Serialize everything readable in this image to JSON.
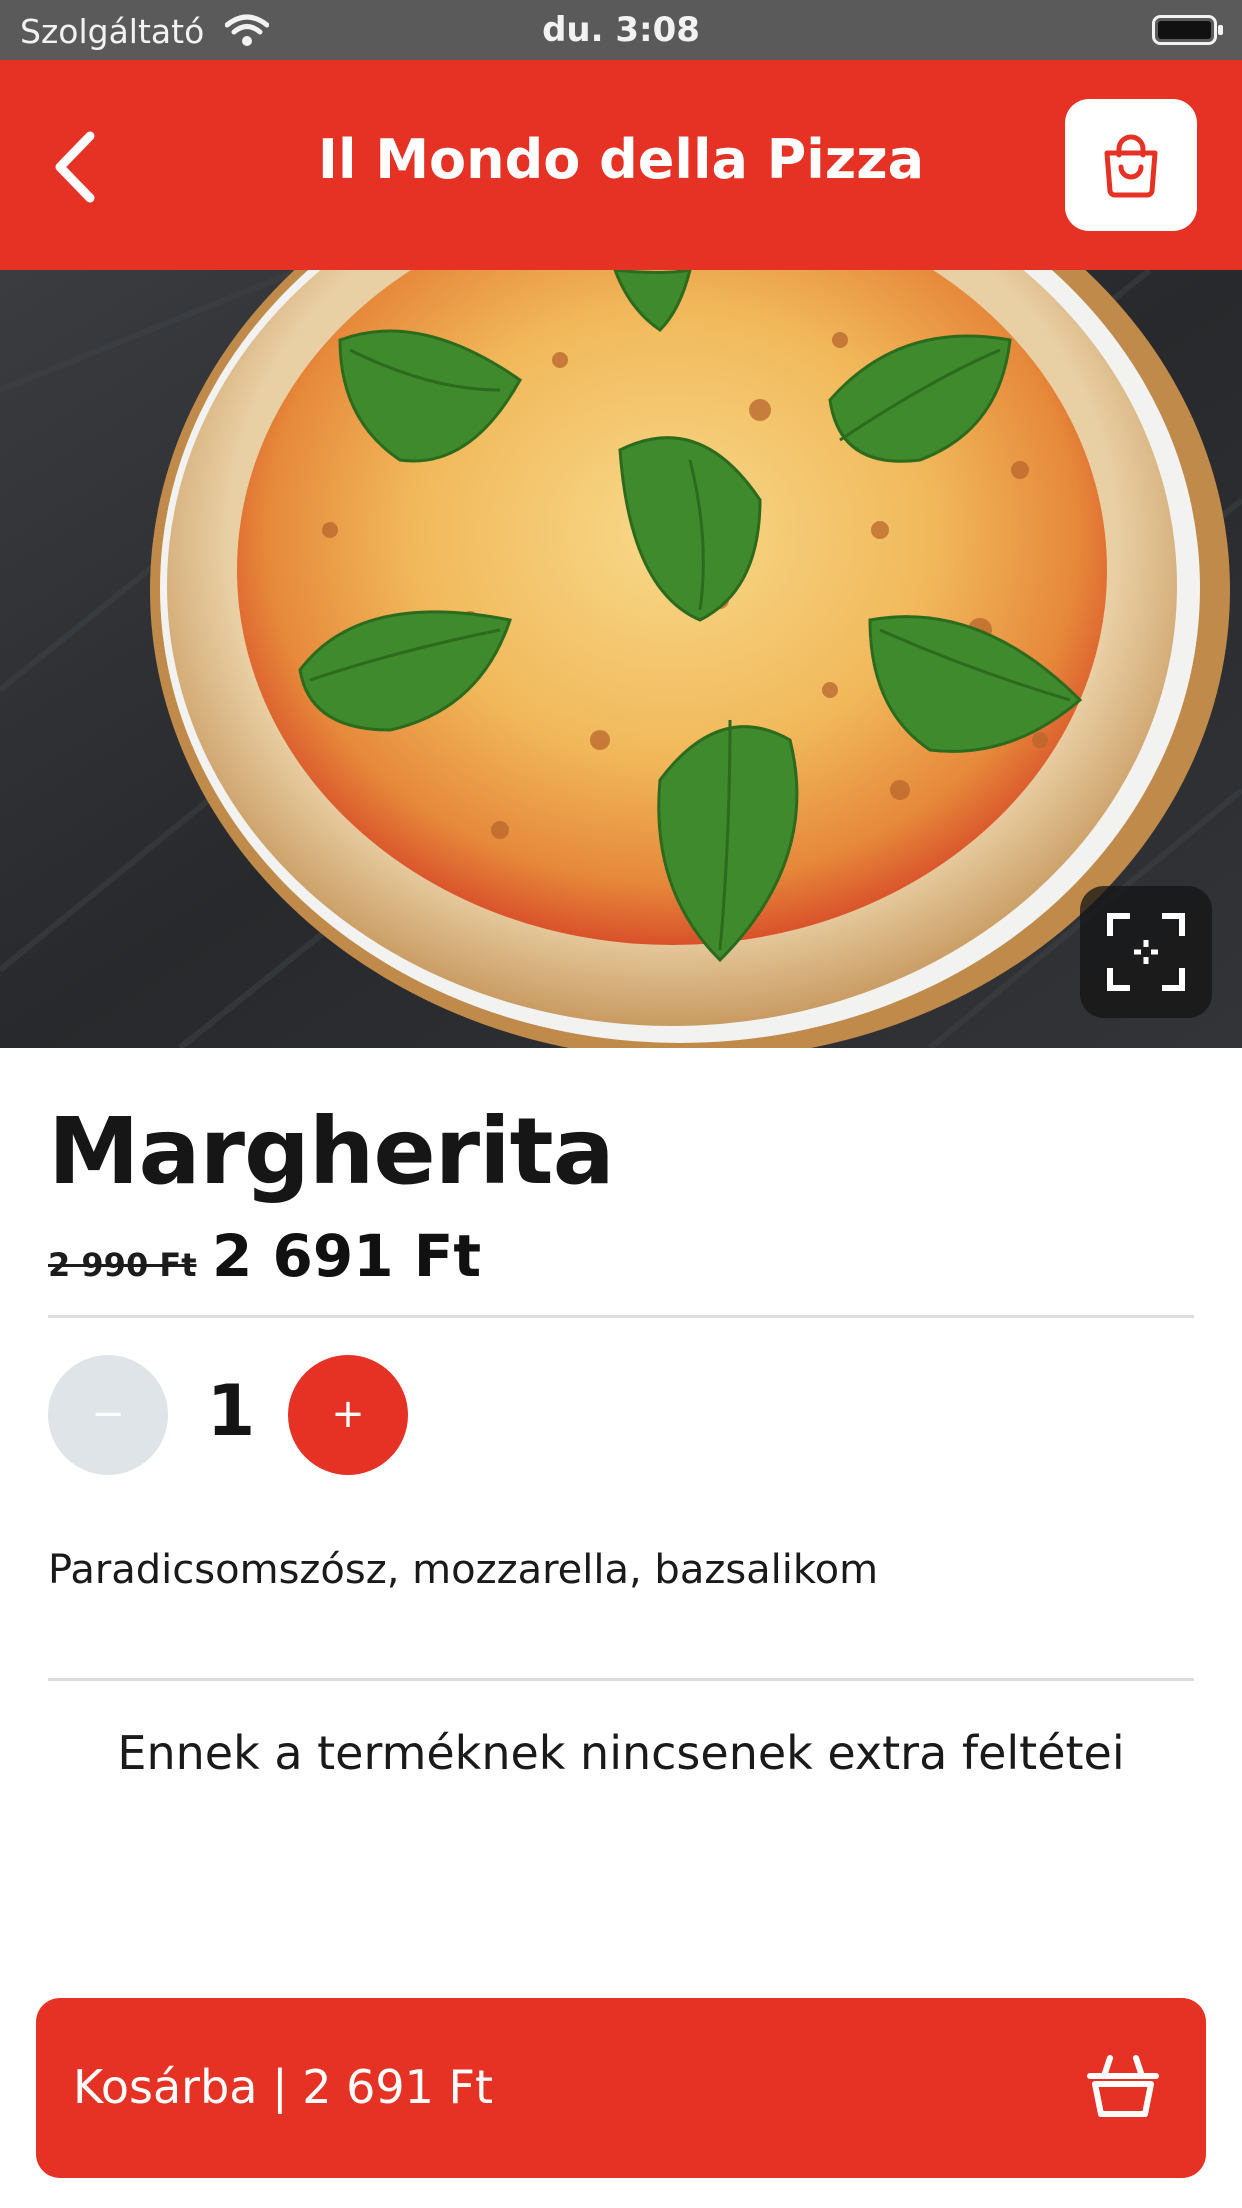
{
  "status_bar": {
    "carrier": "Szolgáltató",
    "time": "du. 3:08",
    "icons": [
      "wifi-icon",
      "battery-icon"
    ]
  },
  "header": {
    "title": "Il Mondo della Pizza",
    "back_icon": "chevron-left-icon",
    "cart_icon": "shopping-bag-icon",
    "background_color": "#e53224"
  },
  "image": {
    "description_icon": "pizza-photo",
    "fullscreen_icon": "fullscreen-icon"
  },
  "product": {
    "name": "Margherita",
    "old_price": "2 990 Ft",
    "price": "2 691 Ft",
    "description": "Paradicsomszósz, mozzarella, bazsalikom"
  },
  "quantity": {
    "value": "1",
    "minus_label": "−",
    "plus_label": "+"
  },
  "extras": {
    "message": "Ennek a terméknek nincsenek extra feltétei"
  },
  "cart_button": {
    "label": "Kosárba | 2 691 Ft",
    "icon": "basket-icon"
  },
  "colors": {
    "accent": "#e53224",
    "minus_button": "#dfe4e8"
  }
}
